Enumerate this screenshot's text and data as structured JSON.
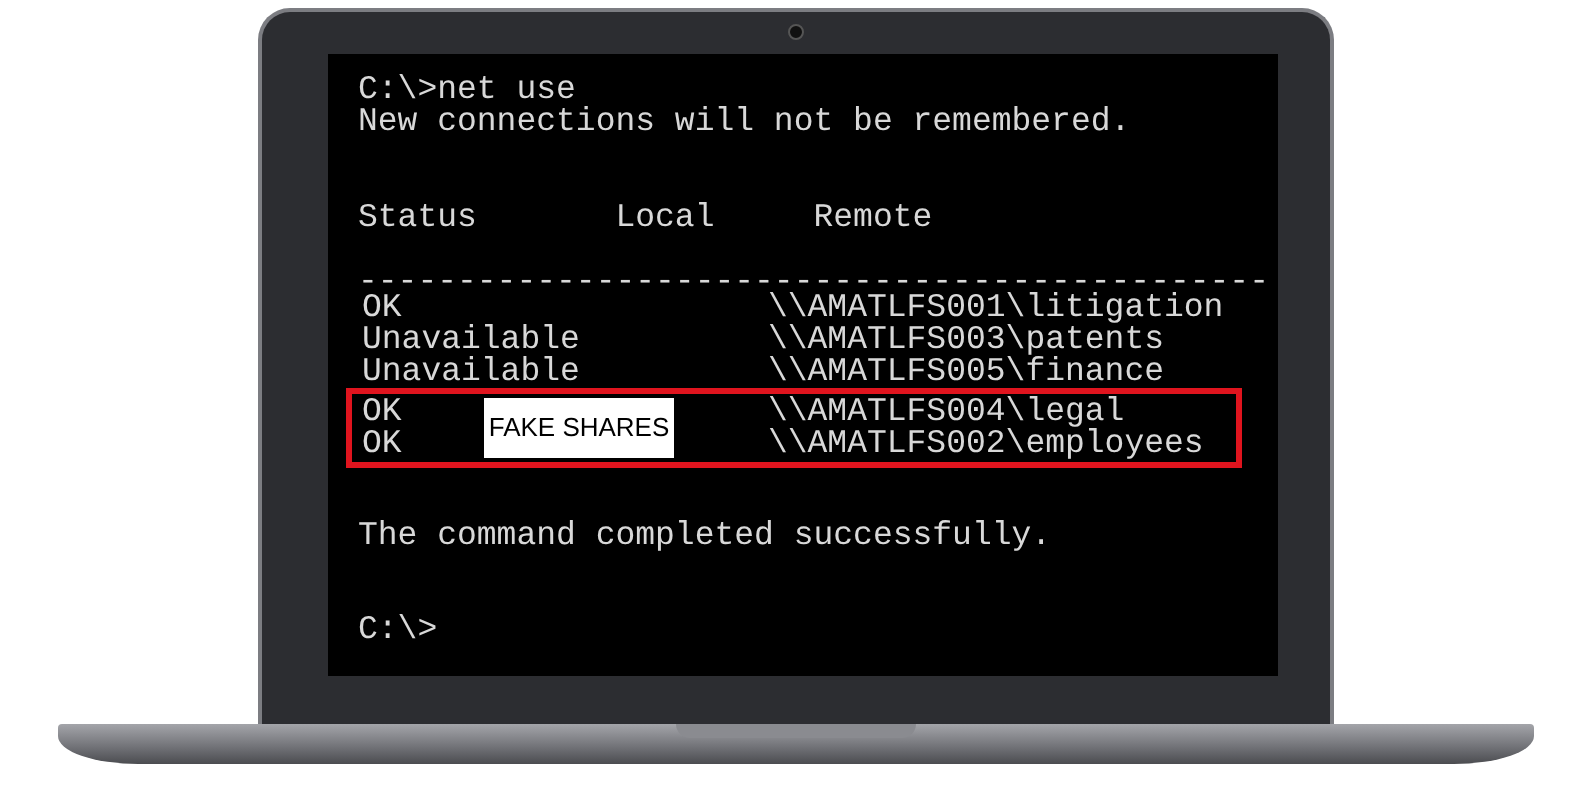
{
  "terminal": {
    "command": "C:\\>net use",
    "message": "New connections will not be remembered.",
    "columns": [
      "Status",
      "Local",
      "Remote"
    ],
    "separator": "----------------------------------------------",
    "rows": [
      {
        "status": "OK",
        "remote": "\\\\AMATLFS001\\litigation",
        "flagged": false
      },
      {
        "status": "Unavailable",
        "remote": "\\\\AMATLFS003\\patents",
        "flagged": false
      },
      {
        "status": "Unavailable",
        "remote": "\\\\AMATLFS005\\finance",
        "flagged": false
      },
      {
        "status": "OK",
        "remote": "\\\\AMATLFS004\\legal",
        "flagged": true
      },
      {
        "status": "OK",
        "remote": "\\\\AMATLFS002\\employees",
        "flagged": true
      }
    ],
    "callout": {
      "label": "FAKE SHARES"
    },
    "result": "The command completed successfully.",
    "prompt": "C:\\>"
  }
}
